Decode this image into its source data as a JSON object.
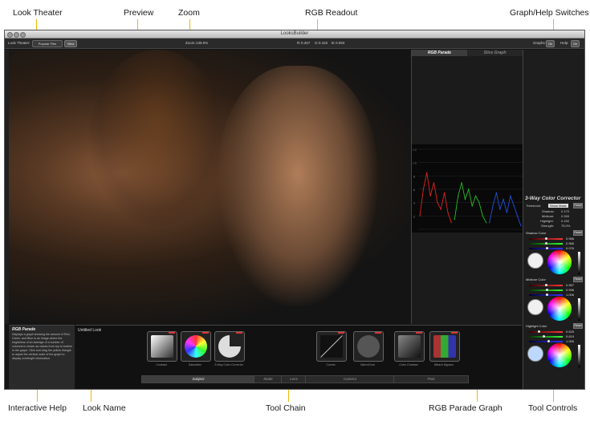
{
  "annotations": {
    "look_theater": "Look Theater",
    "preview": "Preview",
    "zoom": "Zoom",
    "rgb_readout": "RGB Readout",
    "graph_help_switches": "Graph/Help Switches",
    "interactive_help": "Interactive Help",
    "look_name": "Look Name",
    "tool_chain": "Tool Chain",
    "rgb_parade_graph": "RGB Parade Graph",
    "tool_controls": "Tool Controls"
  },
  "window": {
    "title": "LooksBuilder"
  },
  "toolbar": {
    "look_theater_label": "Look Theater:",
    "look_theater_value": "Popular Film",
    "view_button": "View",
    "zoom_label": "Zoom:",
    "zoom_value": "139.0%",
    "r_label": "R:",
    "r_value": "0.267",
    "g_label": "G:",
    "g_value": "0.152",
    "b_label": "B:",
    "b_value": "0.093",
    "graphs_label": "Graphs:",
    "graphs_value": "On",
    "help_label": "Help:",
    "help_value": "On"
  },
  "graph_panel": {
    "tabs": [
      "RGB Parade",
      "Slice Graph"
    ],
    "active_tab": "RGB Parade",
    "axis_labels": [
      "1.2",
      "1.0",
      ".8",
      ".6",
      ".4",
      ".2"
    ]
  },
  "corrector": {
    "title": "3-Way Color Corrector",
    "threshold_label": "Threshold:",
    "threshold_value": "Show Mask",
    "reset_label": "Reset",
    "rows": [
      {
        "label": "Shadow:",
        "value": "0.170"
      },
      {
        "label": "Midtone:",
        "value": "0.269"
      },
      {
        "label": "Highlight:",
        "value": "0.150"
      },
      {
        "label": "Strength:",
        "value": "75.0%"
      }
    ],
    "sections": [
      {
        "name": "Shadow Color",
        "values": [
          "0.966",
          "0.966",
          "0.976"
        ]
      },
      {
        "name": "Midtone Color",
        "values": [
          "0.957",
          "0.996",
          "1.006"
        ]
      },
      {
        "name": "Highlight Color",
        "values": [
          "0.525",
          "0.819",
          "1.065"
        ]
      }
    ]
  },
  "help": {
    "title": "RGB Parade",
    "text": "Displays a graph showing the amount of Red, Green, and Blue in an image where the brightness of an average of a number of columns is shown as values from top to bottom in the graph. Click and drag the yellow triangle to adjust the vertical scale of the graph to display overbright information."
  },
  "tool_chain": {
    "look_name": "Untitled Look",
    "tools": [
      {
        "label": "Contrast"
      },
      {
        "label": "Saturation"
      },
      {
        "label": "3-Way Color Corrector"
      },
      {
        "label": "Curves"
      },
      {
        "label": "Warm/Cool"
      },
      {
        "label": "Color Contrast"
      },
      {
        "label": "Bleach Bypass"
      }
    ],
    "categories": [
      "Subject",
      "Matte",
      "Lens",
      "Camera",
      "Post"
    ],
    "active_category": "Subject"
  },
  "chart_data": {
    "type": "line",
    "title": "RGB Parade",
    "y_ticks": [
      "1.2",
      "1.0",
      ".8",
      ".6",
      ".4",
      ".2"
    ],
    "series": [
      {
        "color": "#e02020",
        "values": [
          0.2,
          0.6,
          0.85,
          0.5,
          0.7,
          0.4,
          0.3,
          0.55,
          0.25,
          0.1
        ]
      },
      {
        "color": "#20c020",
        "values": [
          0.15,
          0.5,
          0.7,
          0.45,
          0.6,
          0.35,
          0.5,
          0.4,
          0.2,
          0.1
        ]
      },
      {
        "color": "#2050e0",
        "values": [
          0.1,
          0.35,
          0.55,
          0.3,
          0.45,
          0.25,
          0.5,
          0.35,
          0.2,
          0.05
        ]
      }
    ],
    "ylim": [
      0,
      1.2
    ],
    "grid": true
  }
}
